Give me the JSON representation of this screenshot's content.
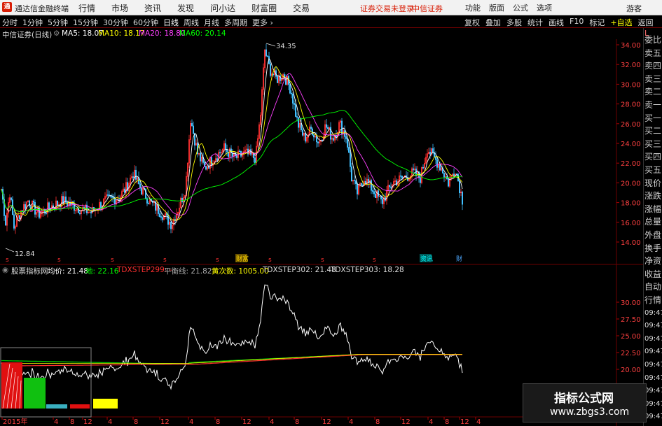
{
  "app": {
    "logo": "通",
    "title": "通达信金融终端"
  },
  "topmenu": [
    "行情",
    "市场",
    "资讯",
    "发现",
    "问小达",
    "财富圈",
    "交易"
  ],
  "login_status": "证券交易未登录",
  "broker": "中信证券",
  "rightmenu": [
    "功能",
    "版面",
    "公式",
    "选项"
  ],
  "guest": "游客",
  "periods": [
    "分时",
    "1分钟",
    "5分钟",
    "15分钟",
    "30分钟",
    "60分钟",
    "日线",
    "周线",
    "月线",
    "多周期",
    "更多 ›"
  ],
  "tools": [
    "复权",
    "叠加",
    "多股",
    "统计",
    "画线",
    "F10",
    "标记",
    "+自选",
    "返回"
  ],
  "price_header": {
    "stock": "中信证券(日线)",
    "ma5": "MA5: 18.07",
    "ma10": "MA10: 18.17",
    "ma20": "MA20: 18.80",
    "ma60": "MA60: 20.14"
  },
  "indicator_header": {
    "name": "股票指标网",
    "avg": "均价: 21.48",
    "base": "地: 22.16",
    "step299": "TDXSTEP299: -",
    "balance": "平衡线: 21.82",
    "yellow": "黄次数: 1005.00",
    "step302": "TDXSTEP302: 21.48",
    "step303": "TDXSTEP303: 18.28"
  },
  "price_axis": [
    "34.00",
    "32.00",
    "30.00",
    "28.00",
    "26.00",
    "24.00",
    "22.00",
    "20.00",
    "18.00",
    "16.00",
    "14.00"
  ],
  "ind_axis": [
    "30.00",
    "27.50",
    "25.00",
    "22.50",
    "20.00"
  ],
  "annotations": {
    "high": "34.35",
    "low": "12.84"
  },
  "markers": {
    "gold": "财富",
    "cyan": "资讯",
    "blue": "财"
  },
  "x_axis": [
    "2015年",
    "4",
    "8",
    "12",
    "4",
    "8",
    "12",
    "4",
    "8",
    "12",
    "4",
    "8",
    "12",
    "4",
    "8",
    "12",
    "4",
    "8",
    "12",
    "4"
  ],
  "sidebar": {
    "corner": "L",
    "items": [
      "委比",
      "卖五",
      "卖四",
      "卖三",
      "卖二",
      "卖一",
      "买一",
      "买二",
      "买三",
      "买四",
      "买五",
      "现价",
      "涨跌",
      "涨幅",
      "总量",
      "外盘",
      "换手",
      "净资",
      "收益",
      "自动",
      "行情",
      "09:47",
      "09:47",
      "09:47",
      "09:47",
      "09:47",
      "09:47",
      "09:47",
      "09:47",
      "09:47"
    ]
  },
  "watermark": {
    "title": "指标公式网",
    "url": "www.zbgs3.com"
  },
  "colors": {
    "background": "#000000",
    "up": "#ff3030",
    "down": "#40c0ff",
    "ma5": "#ffffff",
    "ma10": "#ffff00",
    "ma20": "#ff40ff",
    "ma60": "#00ff00",
    "grid": "#6b0000"
  }
}
